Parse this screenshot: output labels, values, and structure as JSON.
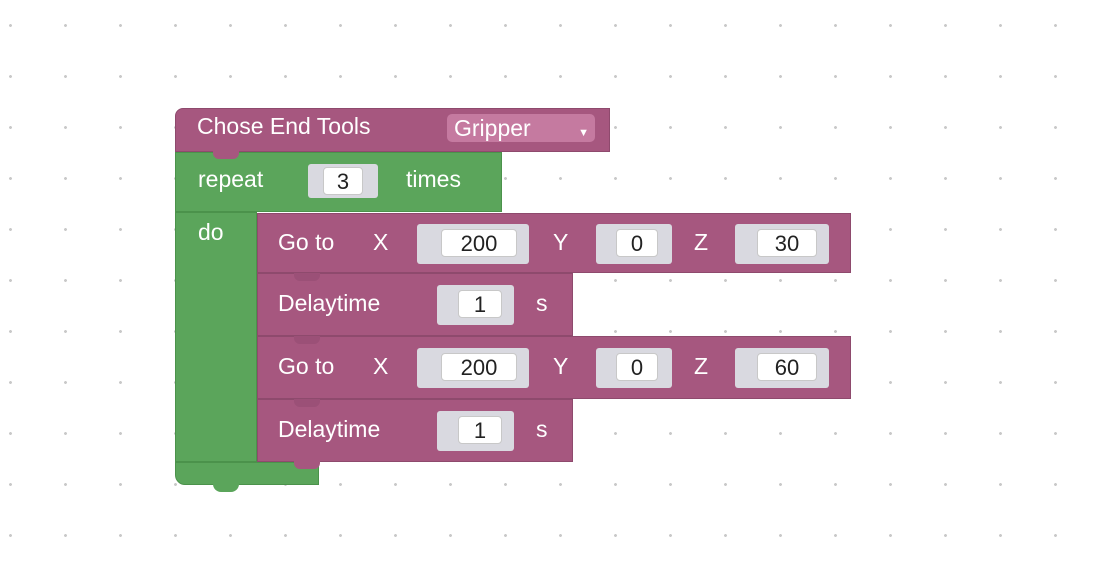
{
  "header_block": {
    "label": "Chose End Tools",
    "tool": "Gripper"
  },
  "repeat_block": {
    "label": "repeat",
    "count": "3",
    "times_label": "times",
    "do_label": "do"
  },
  "steps": [
    {
      "label": "Go to",
      "x_label": "X",
      "x": "200",
      "y_label": "Y",
      "y": "0",
      "z_label": "Z",
      "z": "30"
    },
    {
      "label": "Delaytime",
      "value": "1",
      "unit": "s"
    },
    {
      "label": "Go to",
      "x_label": "X",
      "x": "200",
      "y_label": "Y",
      "y": "0",
      "z_label": "Z",
      "z": "60"
    },
    {
      "label": "Delaytime",
      "value": "1",
      "unit": "s"
    }
  ],
  "colors": {
    "motion_block": "#a6577f",
    "control_block": "#5ba55b"
  },
  "icons": {
    "dropdown": "chevron-down-icon"
  }
}
